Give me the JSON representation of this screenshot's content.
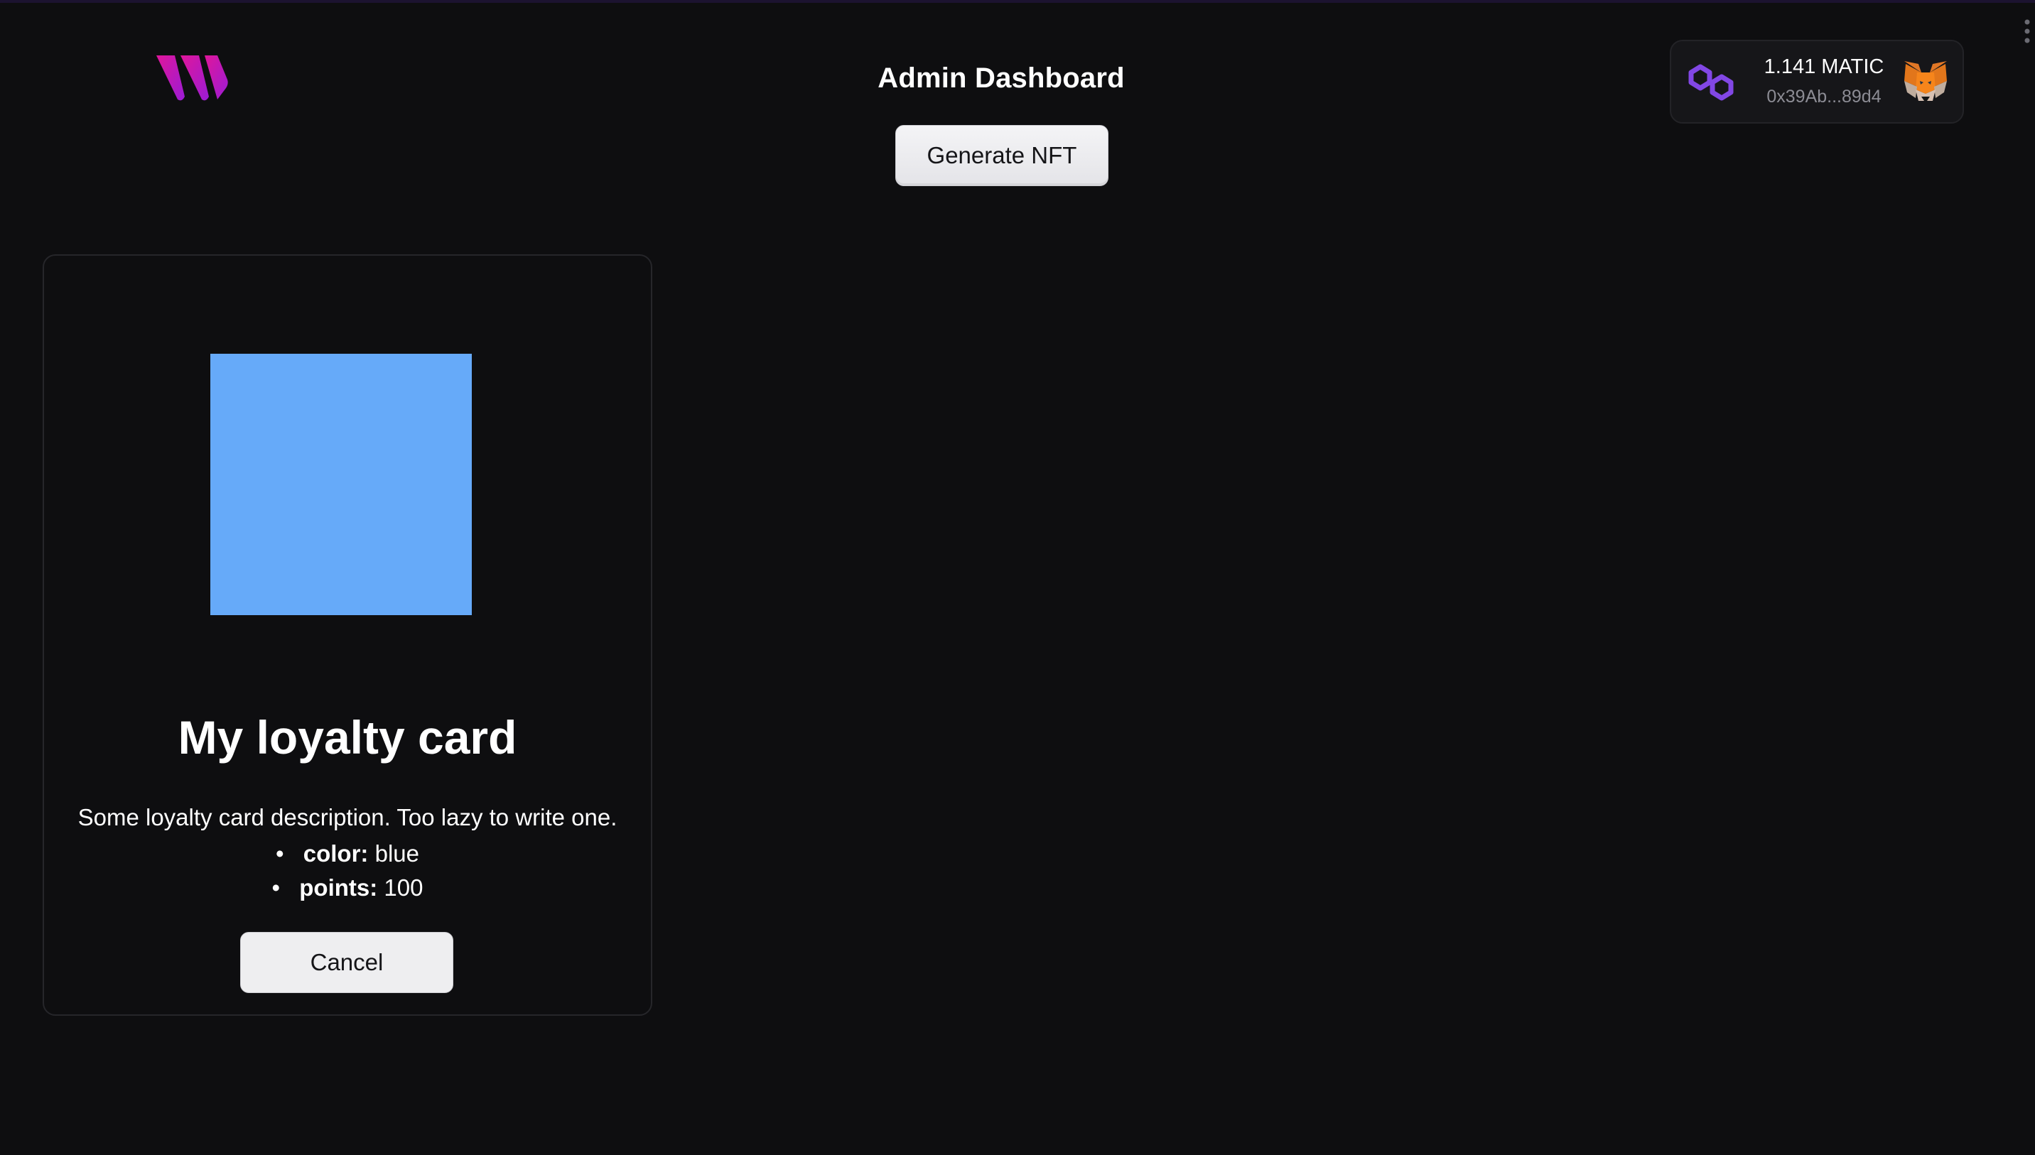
{
  "header": {
    "title": "Admin Dashboard",
    "generate_label": "Generate NFT",
    "logo_icon": "brand-w-logo-icon"
  },
  "wallet": {
    "balance": "1.141 MATIC",
    "address": "0x39Ab...89d4",
    "chain_icon": "polygon-icon",
    "wallet_icon": "metamask-fox-icon"
  },
  "card": {
    "title": "My loyalty card",
    "description": "Some loyalty card description. Too lazy to write one.",
    "image_color": "#66aaf9",
    "attributes": [
      {
        "key": "color:",
        "value": "blue"
      },
      {
        "key": "points:",
        "value": "100"
      }
    ],
    "cancel_label": "Cancel"
  },
  "colors": {
    "background": "#0e0e10",
    "brand": "#d41fa0",
    "polygon": "#8247e5",
    "fox": "#e2761b"
  }
}
